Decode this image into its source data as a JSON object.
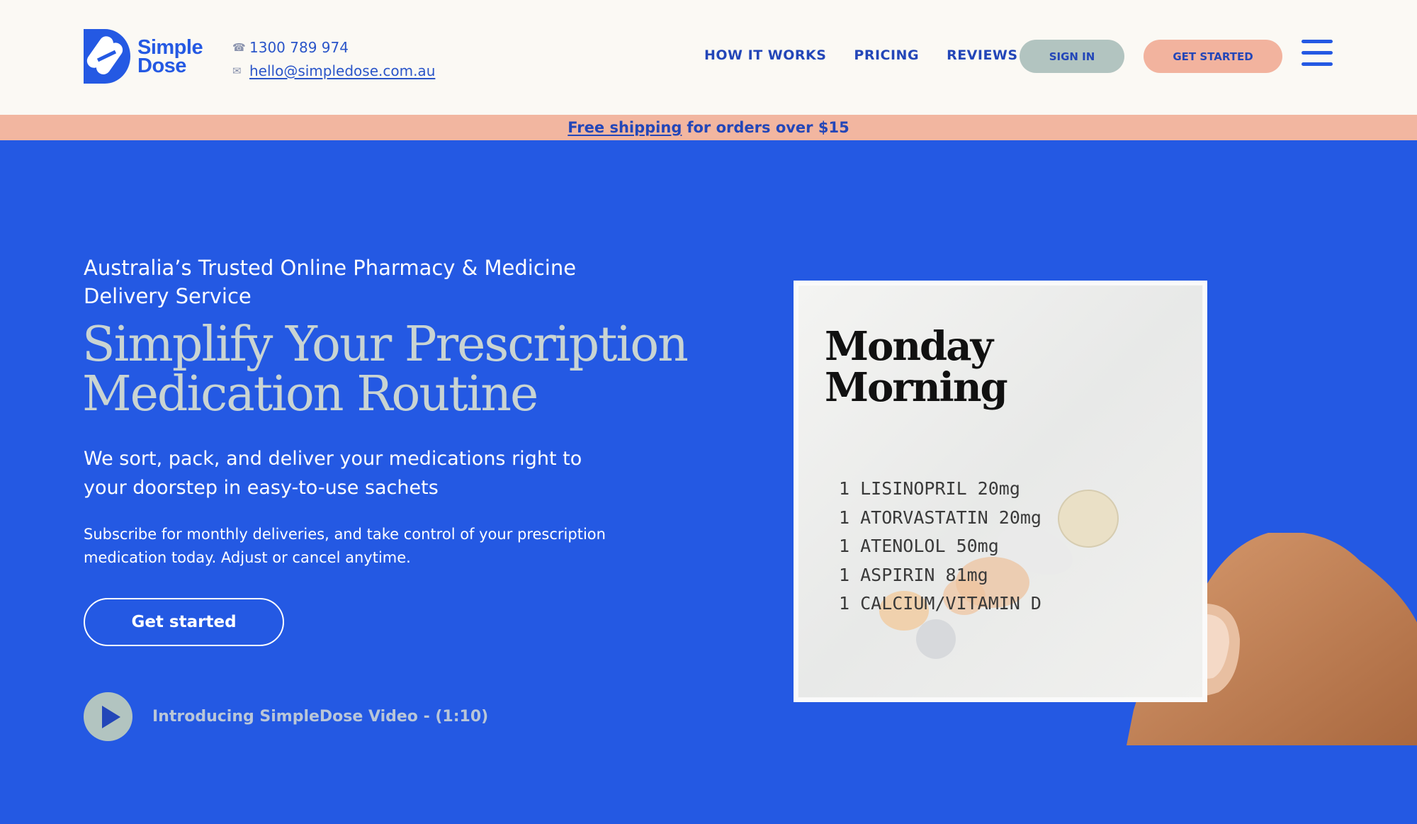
{
  "brand": {
    "name_line1": "Simple",
    "name_line2": "Dose",
    "color": "#2459e3"
  },
  "contact": {
    "phone": "1300 789 974",
    "email": "hello@simpledose.com.au",
    "phone_icon": "phone-icon",
    "email_icon": "envelope-icon"
  },
  "nav": {
    "items": [
      "HOW IT WORKS",
      "PRICING",
      "REVIEWS"
    ]
  },
  "header_buttons": {
    "sign_in": "SIGN IN",
    "get_started": "GET STARTED"
  },
  "promo": {
    "link": "Free shipping",
    "text": "for orders over $15"
  },
  "hero": {
    "eyebrow": "Australia’s Trusted Online Pharmacy & Medicine Delivery Service",
    "title_line1": "Simplify Your Prescription",
    "title_line2": "Medication Routine",
    "subtitle": "We sort, pack, and deliver your medications right to your doorstep in easy-to-use sachets",
    "body": "Subscribe for monthly deliveries, and take control of your prescription medication today. Adjust or cancel anytime.",
    "cta": "Get started",
    "video_label": "Introducing SimpleDose Video - (1:10)"
  },
  "sachet": {
    "title_line1": "Monday",
    "title_line2": "Morning",
    "items": [
      "1 LISINOPRIL 20mg",
      "1 ATORVASTATIN 20mg",
      "1 ATENOLOL 50mg",
      "1 ASPIRIN 81mg",
      "1 CALCIUM/VITAMIN D"
    ]
  },
  "colors": {
    "background": "#2459e3",
    "header": "#fbf9f4",
    "promo": "#f2b6a0",
    "sign_in": "#b2c4c0",
    "get_started": "#f2b39e"
  }
}
